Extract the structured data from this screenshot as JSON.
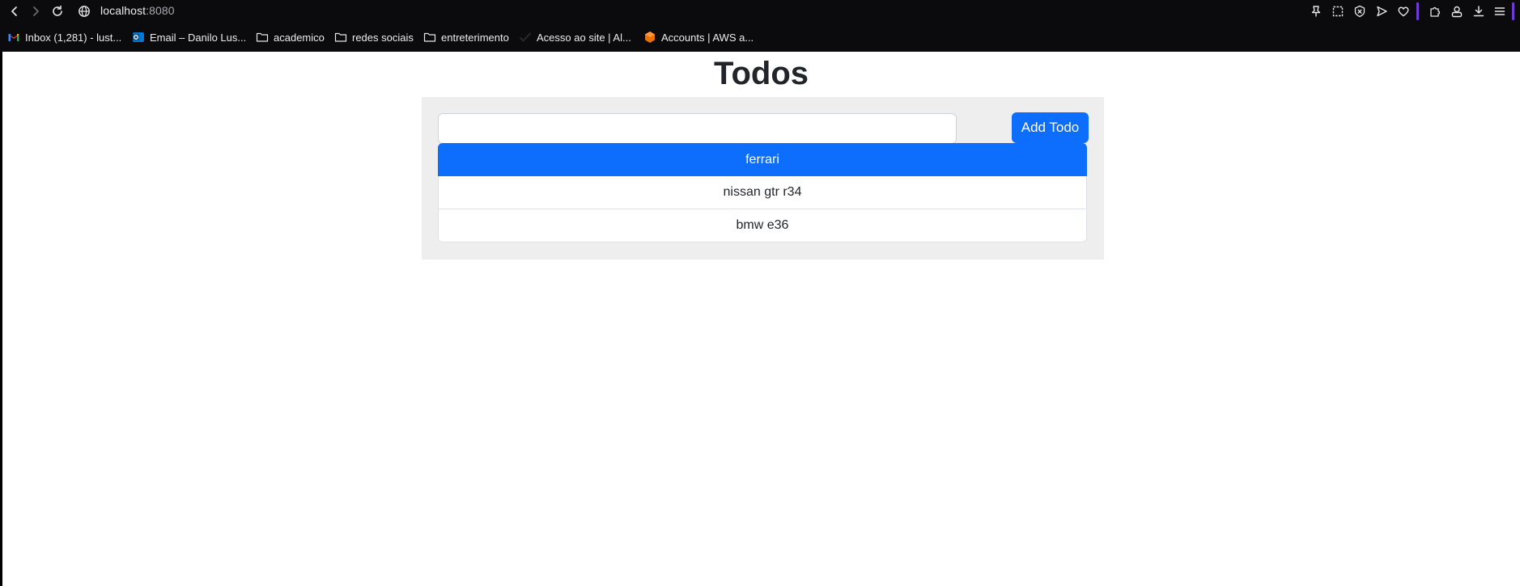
{
  "browser": {
    "url_host": "localhost",
    "url_port": ":8080",
    "bookmarks": [
      {
        "label": "Inbox (1,281) - lust...",
        "icon": "gmail-icon"
      },
      {
        "label": "Email – Danilo Lus...",
        "icon": "outlook-icon"
      },
      {
        "label": "academico",
        "icon": "folder-icon"
      },
      {
        "label": "redes sociais",
        "icon": "folder-icon"
      },
      {
        "label": "entreterimento",
        "icon": "folder-icon"
      },
      {
        "label": "Acesso ao site | Al...",
        "icon": "checkmark-icon"
      },
      {
        "label": "Accounts | AWS a...",
        "icon": "aws-icon"
      }
    ],
    "accent_color": "#6d3bd6"
  },
  "page": {
    "title": "Todos",
    "input": {
      "value": "",
      "placeholder": ""
    },
    "add_button_label": "Add Todo",
    "todos": [
      {
        "text": "ferrari",
        "active": true
      },
      {
        "text": "nissan gtr r34",
        "active": false
      },
      {
        "text": "bmw e36",
        "active": false
      }
    ],
    "colors": {
      "primary": "#0d6efd",
      "panel_bg": "#eeeeee",
      "text": "#212529"
    }
  }
}
